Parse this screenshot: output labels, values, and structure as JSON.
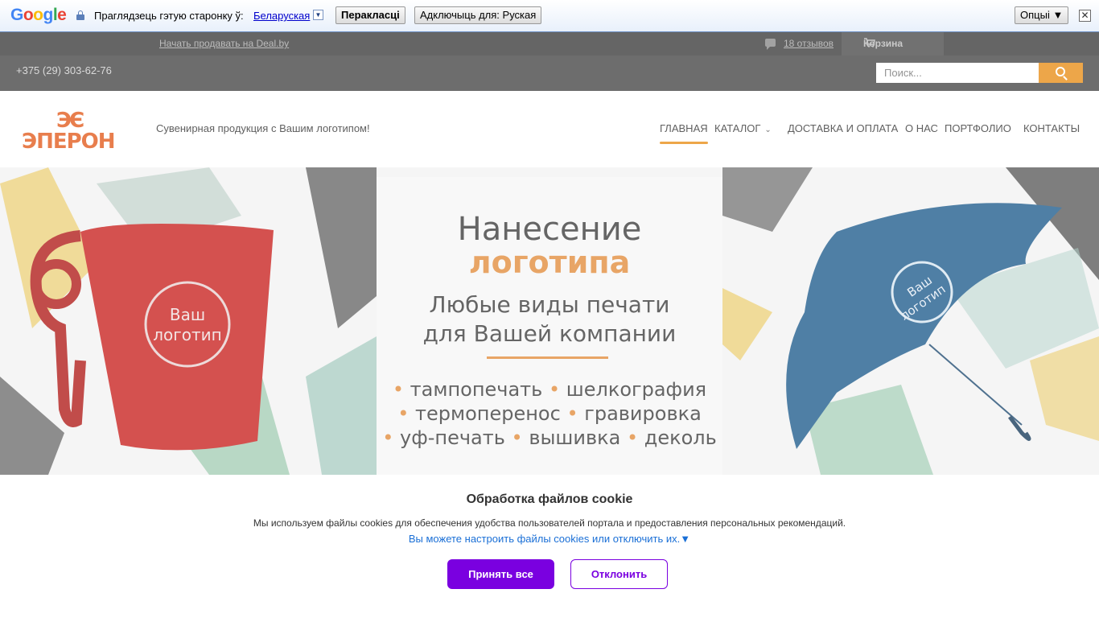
{
  "translate_bar": {
    "logo": "Google",
    "prompt": "Праглядзець гэтую старонку ў:",
    "language": "Беларуская",
    "translate_button": "Перакласці",
    "disable_button": "Адключыць для: Руская",
    "options_button": "Опцыі ▼",
    "close_glyph": "✕",
    "dropdown_glyph": "▼"
  },
  "topbar": {
    "sell_link": "Начать продавать на Deal.by",
    "reviews_link": "18 отзывов",
    "cart_label": "Корзина"
  },
  "phonebar": {
    "phone": "+375 (29) 303-62-76",
    "search_placeholder": "Поиск..."
  },
  "header": {
    "logo_mark": "ЭЄ",
    "logo_text": "ЭПЕРОН",
    "tagline": "Сувенирная продукция с Вашим логотипом!",
    "nav": [
      {
        "label": "Главная",
        "active": true
      },
      {
        "label": "Каталог",
        "has_dropdown": true
      },
      {
        "label": "Доставка и оплата"
      },
      {
        "label": "О нас"
      },
      {
        "label": "Портфолио"
      },
      {
        "label": "Контакты"
      }
    ]
  },
  "banner": {
    "title_line1": "Нанесение",
    "title_line2": "логотипа",
    "subtitle_line1": "Любые виды печати",
    "subtitle_line2": "для Вашей компании",
    "methods": [
      [
        "тампопечать",
        "шелкография"
      ],
      [
        "термоперенос",
        "гравировка"
      ],
      [
        "уф-печать",
        "вышивка",
        "деколь"
      ]
    ],
    "mug_text_1": "Ваш",
    "mug_text_2": "логотип",
    "umbrella_text_1": "Ваш",
    "umbrella_text_2": "логотип",
    "colors": {
      "accent": "#e28c3c",
      "mug": "#c8201e",
      "umbrella": "#1e5b8c"
    }
  },
  "cookie": {
    "title": "Обработка файлов cookie",
    "text": "Мы используем файлы cookies для обеспечения удобства пользователей портала и предоставления персональных рекомендаций.",
    "settings_link": "Вы можете настроить файлы cookies или отключить их.▼",
    "accept_button": "Принять все",
    "decline_button": "Отклонить",
    "colors": {
      "primary": "#7a00e0"
    }
  }
}
